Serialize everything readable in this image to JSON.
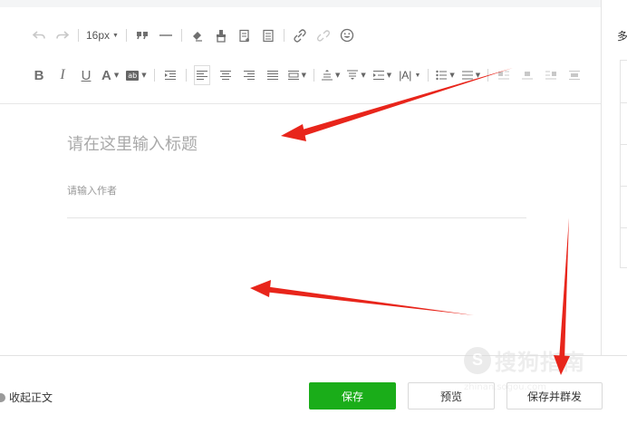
{
  "toolbar": {
    "font_size": "16px",
    "bold": "B",
    "italic": "I",
    "underline": "U",
    "font_color": "A",
    "bg_color": "ab",
    "letter_spacing": "|A|"
  },
  "editor": {
    "title_placeholder": "请在这里输入标题",
    "author_placeholder": "请输入作者"
  },
  "side_panel": {
    "label": "多"
  },
  "bottom": {
    "collapse_label": "收起正文",
    "save_label": "保存",
    "preview_label": "预览",
    "publish_label": "保存并群发"
  },
  "watermark": {
    "glyph": "S",
    "text": "搜狗指南",
    "sub": "zhinan.sogou.com"
  },
  "colors": {
    "save_button": "#1aad19",
    "arrow": "#e8251b",
    "icon": "#6f6f6f"
  },
  "icons": {
    "undo": "undo-icon",
    "redo": "redo-icon",
    "quote": "quote-icon",
    "hr": "horizontal-rule-icon",
    "eraser": "eraser-icon",
    "format_painter": "format-painter-icon",
    "insert": "insert-doc-icon",
    "template": "template-icon",
    "link": "link-icon",
    "unlink": "unlink-icon",
    "emoji": "emoji-icon"
  }
}
